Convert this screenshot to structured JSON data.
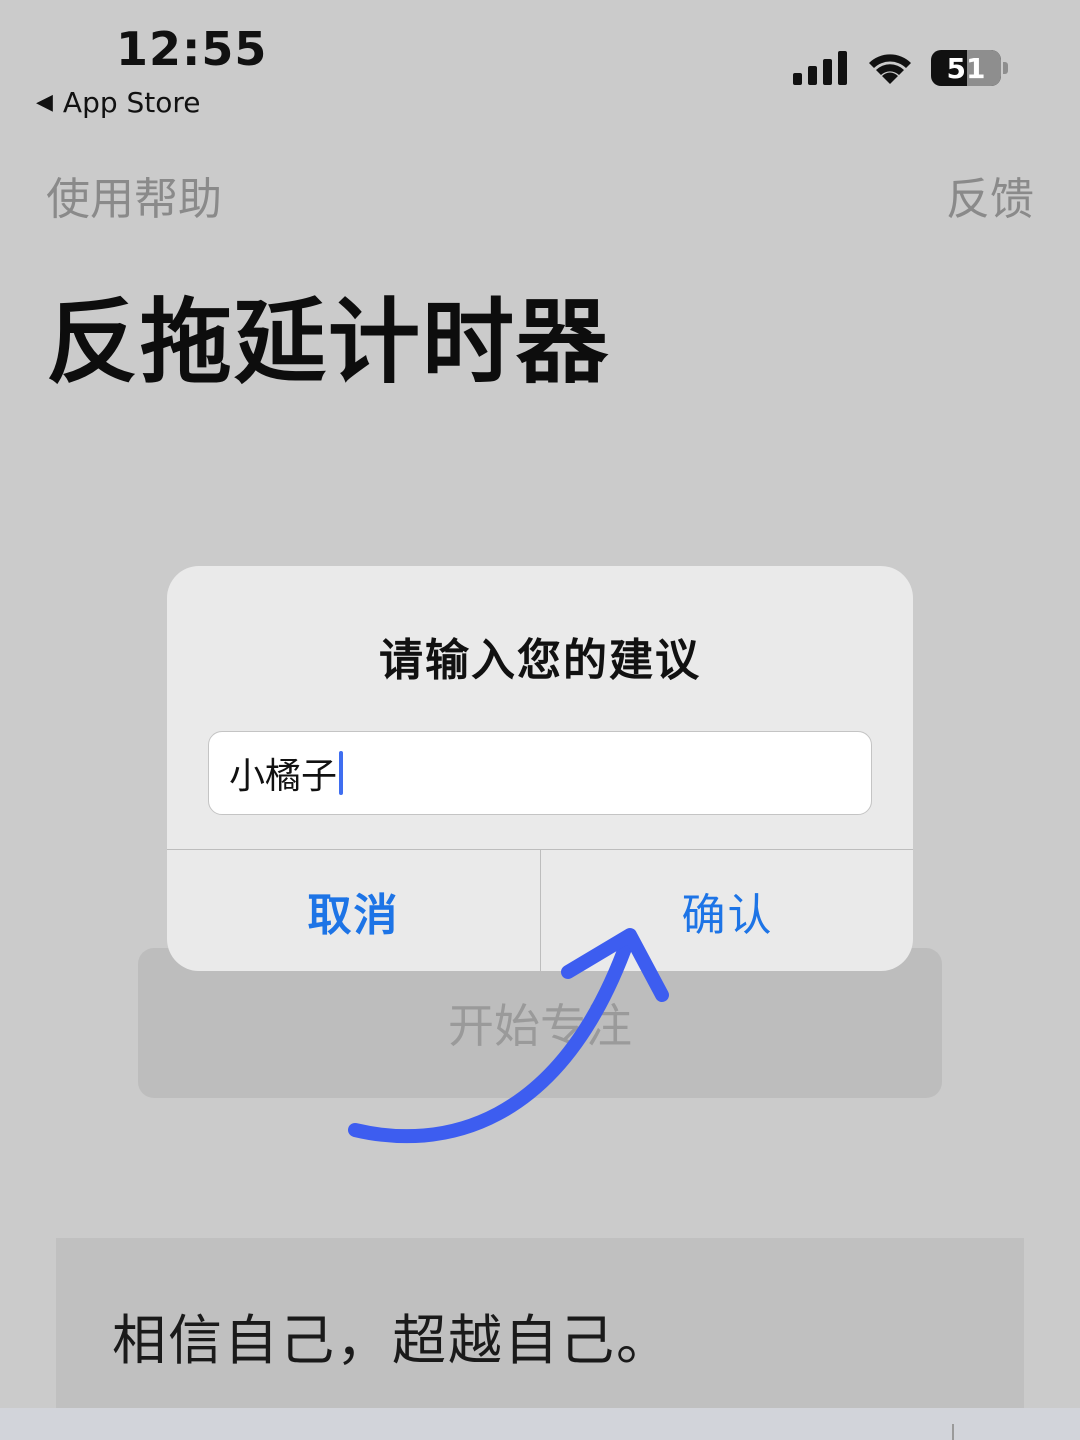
{
  "status_bar": {
    "time": "12:55",
    "back_label": "App Store",
    "battery": "51",
    "icons": [
      "signal-bars-icon",
      "wifi-icon",
      "battery-icon"
    ]
  },
  "nav": {
    "left": "使用帮助",
    "right": "反馈"
  },
  "page": {
    "title": "反拖延计时器",
    "start_button": "开始专注",
    "motto": "相信自己，超越自己。"
  },
  "dialog": {
    "title": "请输入您的建议",
    "input_value": "小橘子",
    "cancel_label": "取消",
    "confirm_label": "确认"
  },
  "colors": {
    "accent": "#1d74e6",
    "annotation_arrow": "#3d5df0",
    "caret": "#3f6ef0"
  }
}
